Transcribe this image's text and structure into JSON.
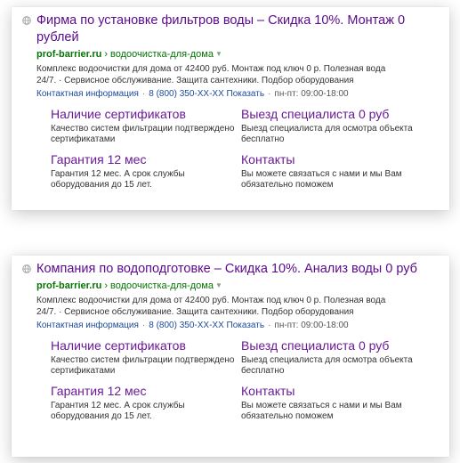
{
  "ads": [
    {
      "title": "Фирма по установке фильтров воды – Скидка 10%. Монтаж 0 рублей",
      "domain": "prof-barrier.ru",
      "path": "водоочистка-для-дома",
      "url_sep": "›",
      "description": "Комплекс водоочистки для дома от 42400 руб. Монтаж под ключ 0 р. Полезная вода 24/7. · Сервисное обслуживание. Защита сантехники. Подбор оборудования",
      "contact_info": "Контактная информация",
      "phone": "8 (800) 350-XX-XX",
      "phone_show": "Показать",
      "hours": "пн-пт: 09:00-18:00",
      "sitelinks": [
        {
          "title": "Наличие сертификатов",
          "desc": "Качество систем фильтрации подтверждено сертификатами"
        },
        {
          "title": "Выезд специалиста 0 руб",
          "desc": "Выезд специалиста для осмотра объекта бесплатно"
        },
        {
          "title": "Гарантия 12 мес",
          "desc": "Гарантия 12 мес. А срок службы оборудования до 15 лет."
        },
        {
          "title": "Контакты",
          "desc": "Вы можете связаться с нами и мы Вам обязательно поможем"
        }
      ]
    },
    {
      "title": "Компания по водоподготовке – Скидка 10%. Анализ воды 0 руб",
      "domain": "prof-barrier.ru",
      "path": "водоочистка-для-дома",
      "url_sep": "›",
      "description": "Комплекс водоочистки для дома от 42400 руб. Монтаж под ключ 0 р. Полезная вода 24/7. · Сервисное обслуживание. Защита сантехники. Подбор оборудования",
      "contact_info": "Контактная информация",
      "phone": "8 (800) 350-XX-XX",
      "phone_show": "Показать",
      "hours": "пн-пт: 09:00-18:00",
      "sitelinks": [
        {
          "title": "Наличие сертификатов",
          "desc": "Качество систем фильтрации подтверждено сертификатами"
        },
        {
          "title": "Выезд специалиста 0 руб",
          "desc": "Выезд специалиста для осмотра объекта бесплатно"
        },
        {
          "title": "Гарантия 12 мес",
          "desc": "Гарантия 12 мес. А срок службы оборудования до 15 лет."
        },
        {
          "title": "Контакты",
          "desc": "Вы можете связаться с нами и мы Вам обязательно поможем"
        }
      ]
    }
  ],
  "icons": {
    "favicon": "globe-icon",
    "url_dropdown": "triangle-down-icon"
  },
  "colors": {
    "title": "#5a0a8c",
    "url": "#077307",
    "link": "#1c4a9b",
    "sitelink": "#6a1a96"
  }
}
